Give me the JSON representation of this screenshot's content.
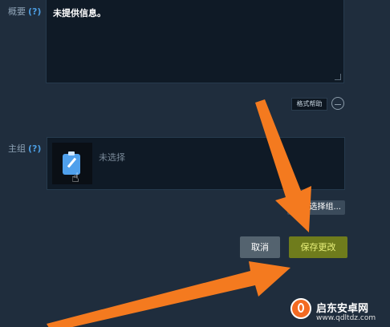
{
  "summary": {
    "label": "概要",
    "help": "(?)",
    "value": "未提供信息。"
  },
  "format_help_label": "格式帮助",
  "main_group": {
    "label": "主组",
    "help": "(?)",
    "value": "未选择",
    "choose_button": "选择组..."
  },
  "actions": {
    "cancel": "取消",
    "save": "保存更改"
  },
  "watermark": {
    "name": "启东安卓网",
    "url": "www.qdltdz.com"
  },
  "colors": {
    "background": "#1f2d3d",
    "save_button": "#6f7c1c",
    "arrow": "#f47a1f"
  }
}
